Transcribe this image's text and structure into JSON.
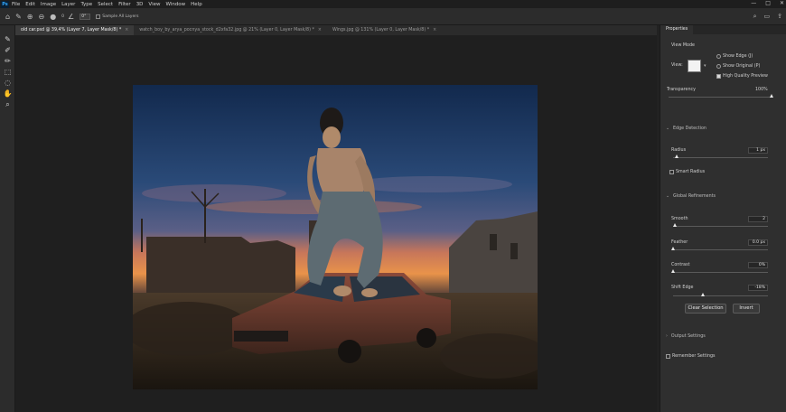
{
  "menubar": {
    "logo": "Ps",
    "items": [
      "File",
      "Edit",
      "Image",
      "Layer",
      "Type",
      "Select",
      "Filter",
      "3D",
      "View",
      "Window",
      "Help"
    ],
    "window_controls": [
      "—",
      "□",
      "✕"
    ]
  },
  "options_bar": {
    "brush_size": "0",
    "angle_value": "0°",
    "sample_all_layers": "Sample All Layers"
  },
  "tabs": [
    {
      "label": "old car.psd @ 39,4% (Layer 7, Layer Mask/8) *",
      "active": true
    },
    {
      "label": "watch_boy_by_arya_pocnya_stock_d2xfa32.jpg @ 21% (Layer 0, Layer Mask/8) *",
      "active": false
    },
    {
      "label": "Wings.jpg @ 131% (Layer 0, Layer Mask/8) *",
      "active": false
    }
  ],
  "properties": {
    "tab_label": "Properties",
    "view_mode": {
      "title": "View Mode",
      "view_label": "View:",
      "show_edge": "Show Edge (J)",
      "show_original": "Show Original (P)",
      "high_quality": "High Quality Preview",
      "high_quality_checked": true
    },
    "transparency": {
      "label": "Transparency",
      "value": "100%",
      "fraction": 1.0
    },
    "edge_detection": {
      "title": "Edge Detection",
      "radius_label": "Radius",
      "radius_value": "1 px",
      "radius_fraction": 0.01,
      "smart_radius": "Smart Radius"
    },
    "global_refinements": {
      "title": "Global Refinements",
      "smooth_label": "Smooth",
      "smooth_value": "2",
      "smooth_fraction": 0.02,
      "feather_label": "Feather",
      "feather_value": "0.0 px",
      "feather_fraction": 0.0,
      "contrast_label": "Contrast",
      "contrast_value": "0%",
      "contrast_fraction": 0.0,
      "shift_edge_label": "Shift Edge",
      "shift_edge_value": "-18%",
      "shift_edge_fraction": 0.32
    },
    "buttons": {
      "clear_selection": "Clear Selection",
      "invert": "Invert"
    },
    "output_settings": "Output Settings",
    "remember_settings": "Remember Settings"
  },
  "colors": {
    "accent_blue": "#31a8ff",
    "panel_bg": "#2f2f2f",
    "canvas_bg": "#1f1f1f"
  },
  "icons": {
    "tools": [
      "brush-icon",
      "refine-edge-brush-icon",
      "brush-icon",
      "object-selection-icon",
      "lasso-icon",
      "hand-icon",
      "zoom-icon"
    ]
  }
}
